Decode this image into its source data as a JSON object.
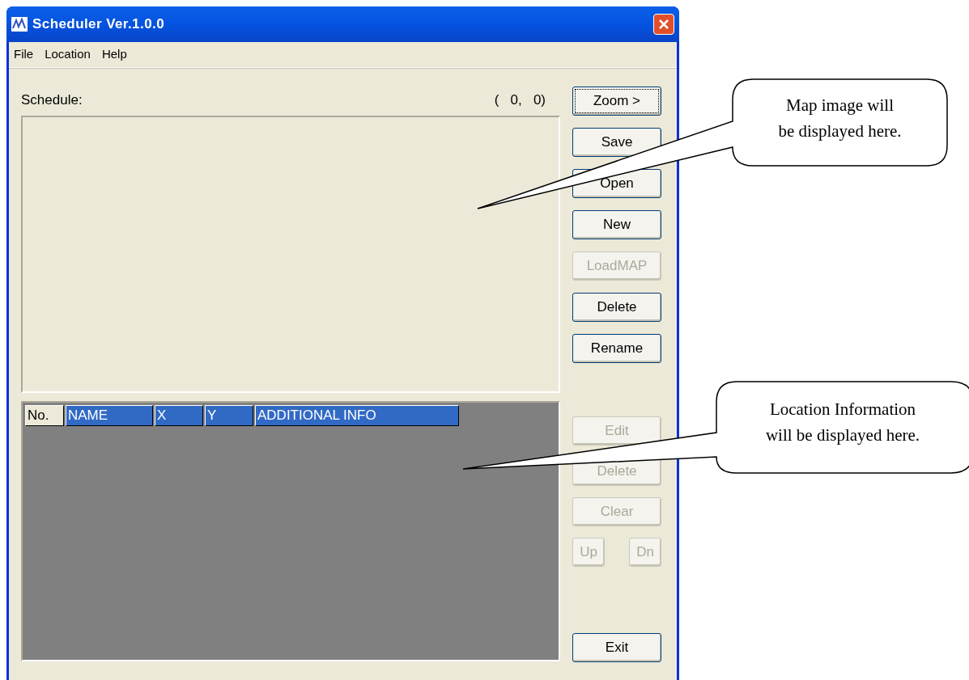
{
  "window": {
    "title": "Scheduler Ver.1.0.0"
  },
  "menu": [
    "File",
    "Location",
    "Help"
  ],
  "schedule_label": "Schedule:",
  "coordinates": "(   0,   0)",
  "top_buttons": [
    {
      "label": "Zoom >",
      "disabled": false,
      "focused": true
    },
    {
      "label": "Save",
      "disabled": false,
      "focused": false
    },
    {
      "label": "Open",
      "disabled": false,
      "focused": false
    },
    {
      "label": "New",
      "disabled": false,
      "focused": false
    },
    {
      "label": "LoadMAP",
      "disabled": true,
      "focused": false
    },
    {
      "label": "Delete",
      "disabled": false,
      "focused": false
    },
    {
      "label": "Rename",
      "disabled": false,
      "focused": false
    }
  ],
  "table": {
    "columns": [
      {
        "label": "No.",
        "selected": false
      },
      {
        "label": "NAME",
        "selected": true
      },
      {
        "label": "X",
        "selected": true
      },
      {
        "label": "Y",
        "selected": true
      },
      {
        "label": "ADDITIONAL INFO",
        "selected": true
      }
    ]
  },
  "bottom_buttons": [
    {
      "label": "Edit",
      "kind": "wide",
      "disabled": true
    },
    {
      "label": "Delete",
      "kind": "wide",
      "disabled": true
    },
    {
      "label": "Clear",
      "kind": "wide",
      "disabled": true
    },
    {
      "label": "Up",
      "kind": "small",
      "disabled": true
    },
    {
      "label": "Dn",
      "kind": "small",
      "disabled": true
    },
    {
      "label": "Exit",
      "kind": "exit",
      "disabled": false
    }
  ],
  "callouts": [
    {
      "lines": [
        "Map image will",
        "be displayed here."
      ]
    },
    {
      "lines": [
        "Location Information",
        "will be displayed here."
      ]
    }
  ]
}
